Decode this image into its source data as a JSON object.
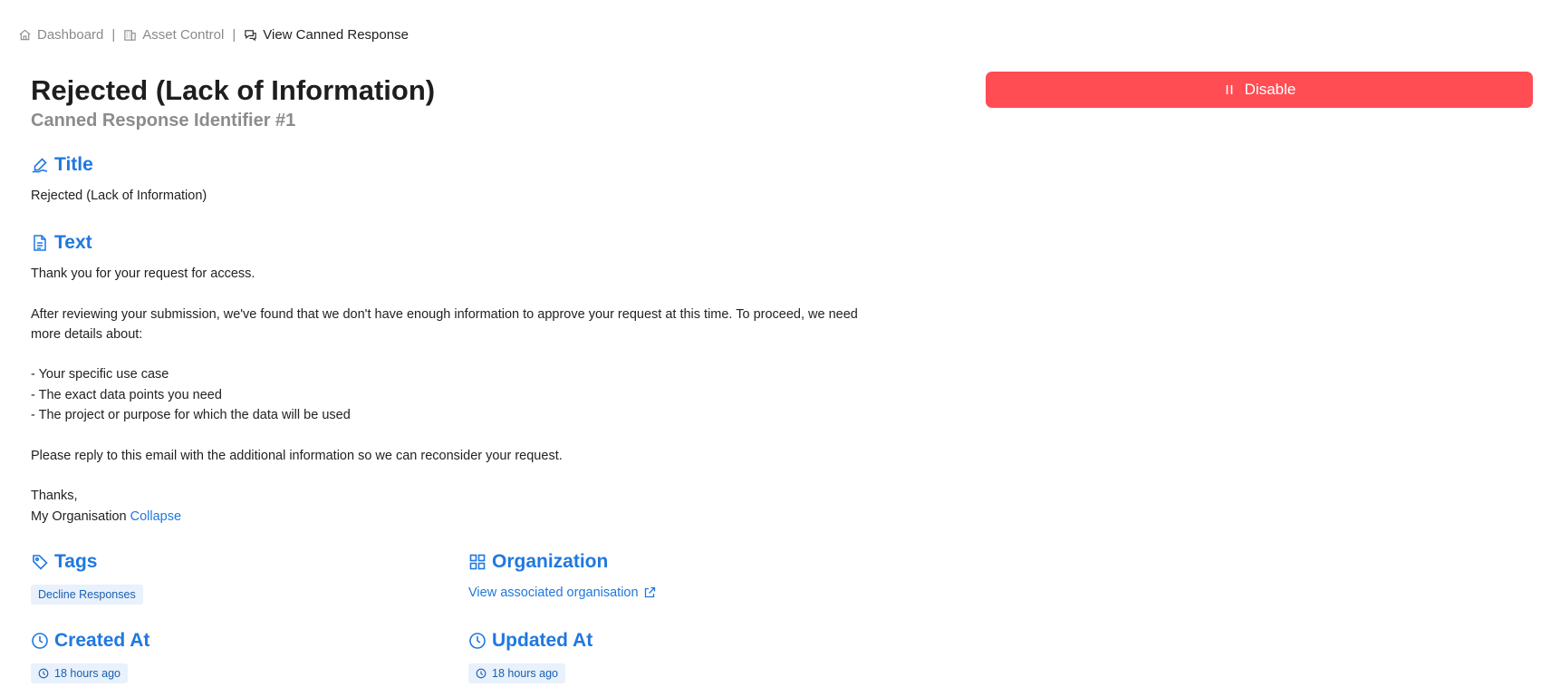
{
  "breadcrumb": {
    "items": [
      {
        "label": "Dashboard",
        "icon": "home-icon"
      },
      {
        "label": "Asset Control",
        "icon": "building-icon"
      },
      {
        "label": "View Canned Response",
        "icon": "chat-icon"
      }
    ],
    "separator": "|"
  },
  "header": {
    "title": "Rejected (Lack of Information)",
    "subtitle": "Canned Response Identifier #1"
  },
  "actions": {
    "disable_label": "Disable",
    "disable_color": "#ff4d53"
  },
  "sections": {
    "title": {
      "heading": "Title",
      "value": "Rejected (Lack of Information)"
    },
    "text": {
      "heading": "Text",
      "lines": [
        "Thank you for your request for access.",
        "",
        "After reviewing your submission, we've found that we don't have enough information to approve your request at this time. To proceed, we need",
        "more details about:",
        "",
        "- Your specific use case",
        "- The exact data points you need",
        "- The project or purpose for which the data will be used",
        "",
        "Please reply to this email with the additional information so we can reconsider your request.",
        "",
        "Thanks,"
      ],
      "last_line": "My Organisation",
      "collapse_label": "Collapse"
    },
    "tags": {
      "heading": "Tags",
      "items": [
        "Decline Responses"
      ]
    },
    "organization": {
      "heading": "Organization",
      "link_label": "View associated organisation"
    },
    "created_at": {
      "heading": "Created At",
      "value": "18 hours ago"
    },
    "updated_at": {
      "heading": "Updated At",
      "value": "18 hours ago"
    }
  },
  "colors": {
    "accent": "#1f78e0",
    "danger": "#ff4d53",
    "chip_bg": "#e8f1fc"
  }
}
